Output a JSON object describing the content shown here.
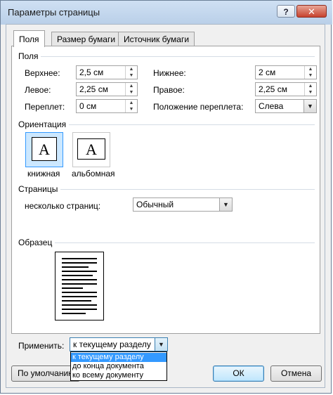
{
  "window": {
    "title": "Параметры страницы",
    "help": "?",
    "close": "✕"
  },
  "tabs": [
    "Поля",
    "Размер бумаги",
    "Источник бумаги"
  ],
  "margins": {
    "header": "Поля",
    "top_label": "Верхнее:",
    "top_value": "2,5 см",
    "left_label": "Левое:",
    "left_value": "2,25 см",
    "gutter_label": "Переплет:",
    "gutter_value": "0 см",
    "bottom_label": "Нижнее:",
    "bottom_value": "2 см",
    "right_label": "Правое:",
    "right_value": "2,25 см",
    "gutter_pos_label": "Положение переплета:",
    "gutter_pos_value": "Слева"
  },
  "orientation": {
    "header": "Ориентация",
    "glyph": "A",
    "portrait": "книжная",
    "landscape": "альбомная",
    "selected": "portrait"
  },
  "pages": {
    "header": "Страницы",
    "multiple_label": "несколько страниц:",
    "multiple_value": "Обычный"
  },
  "preview": {
    "header": "Образец"
  },
  "apply": {
    "label": "Применить:",
    "value": "к текущему разделу",
    "options": [
      "к текущему разделу",
      "до конца документа",
      "ко всему документу"
    ],
    "highlighted_index": 0
  },
  "buttons": {
    "default": "По умолчанию",
    "ok": "ОК",
    "cancel": "Отмена"
  },
  "icons": {
    "spin_up": "▲",
    "spin_down": "▼",
    "dropdown": "▼"
  }
}
